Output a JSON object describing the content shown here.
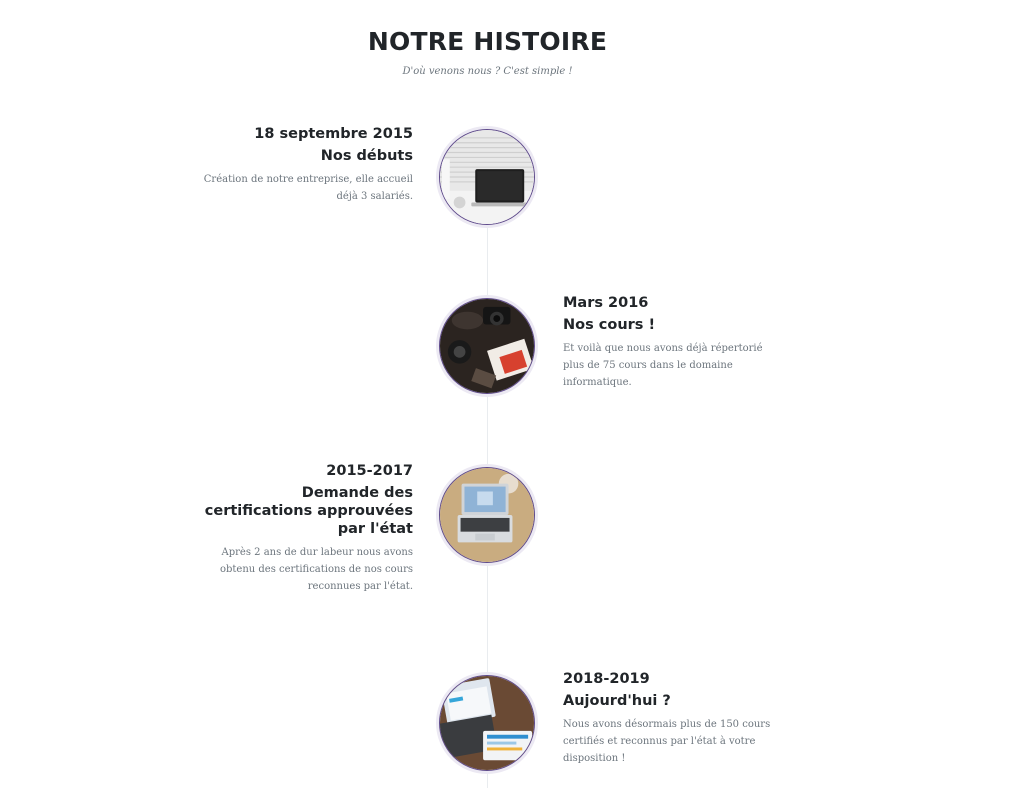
{
  "section": {
    "title": "NOTRE HISTOIRE",
    "subtitle": "D'où venons nous ? C'est simple !"
  },
  "timeline": [
    {
      "date": "18 septembre 2015",
      "heading": "Nos débuts",
      "body": "Création de notre entreprise, elle accueil déjà 3 salariés.",
      "side": "left",
      "image": "laptop-on-desk-photo"
    },
    {
      "date": "Mars 2016",
      "heading": "Nos cours !",
      "body": "Et voilà que nous avons déjà répertorié plus de 75 cours dans le domaine informatique.",
      "side": "right",
      "image": "camera-and-books-photo"
    },
    {
      "date": "2015-2017",
      "heading": "Demande des certifications approuvées par l'état",
      "body": "Après 2 ans de dur labeur nous avons obtenu des certifications de nos cours reconnues par l'état.",
      "side": "left",
      "image": "open-laptop-on-table-photo"
    },
    {
      "date": "2018-2019",
      "heading": "Aujourd'hui ?",
      "body": "Nous avons désormais plus de 150 cours certifiés et reconnus par l'état à votre disposition !",
      "side": "right",
      "image": "laptop-and-tablet-dashboard-photo"
    }
  ],
  "colors": {
    "heading": "#212529",
    "muted": "#6c757d",
    "accent": "#5f4b8b",
    "ring": "#ece9f3",
    "line": "#e9ecef"
  }
}
